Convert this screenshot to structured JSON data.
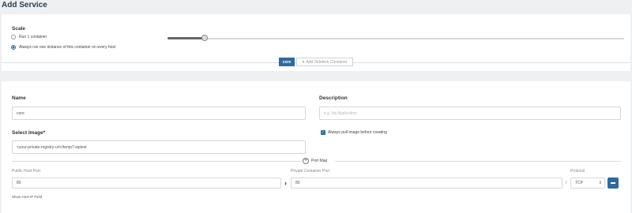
{
  "page": {
    "title": "Add Service"
  },
  "scale": {
    "label": "Scale",
    "options": [
      {
        "label": "Run 1 container",
        "checked": false
      },
      {
        "label": "Always run one instance of this container on every host",
        "checked": true
      }
    ]
  },
  "containers": {
    "active_tab": "core",
    "add_sidekick_label": "Add Sidekick Container"
  },
  "form": {
    "name_label": "Name",
    "name_value": "core",
    "description_label": "Description",
    "description_placeholder": "e.g. My Application",
    "image_label": "Select Image*",
    "image_value": "<your-private-registry-url>/temp7:wptest",
    "pull_label": "Always pull image before creating",
    "pull_checked": true
  },
  "ports": {
    "port_map_label": "Port Map",
    "public_label": "Public Host Port",
    "private_label": "Private Container Port",
    "protocol_label": "Protocol",
    "public_value": "80",
    "private_value": "80",
    "separator": "/",
    "protocol_value": "TCP",
    "show_host_ip_label": "Show Host IP Field"
  }
}
